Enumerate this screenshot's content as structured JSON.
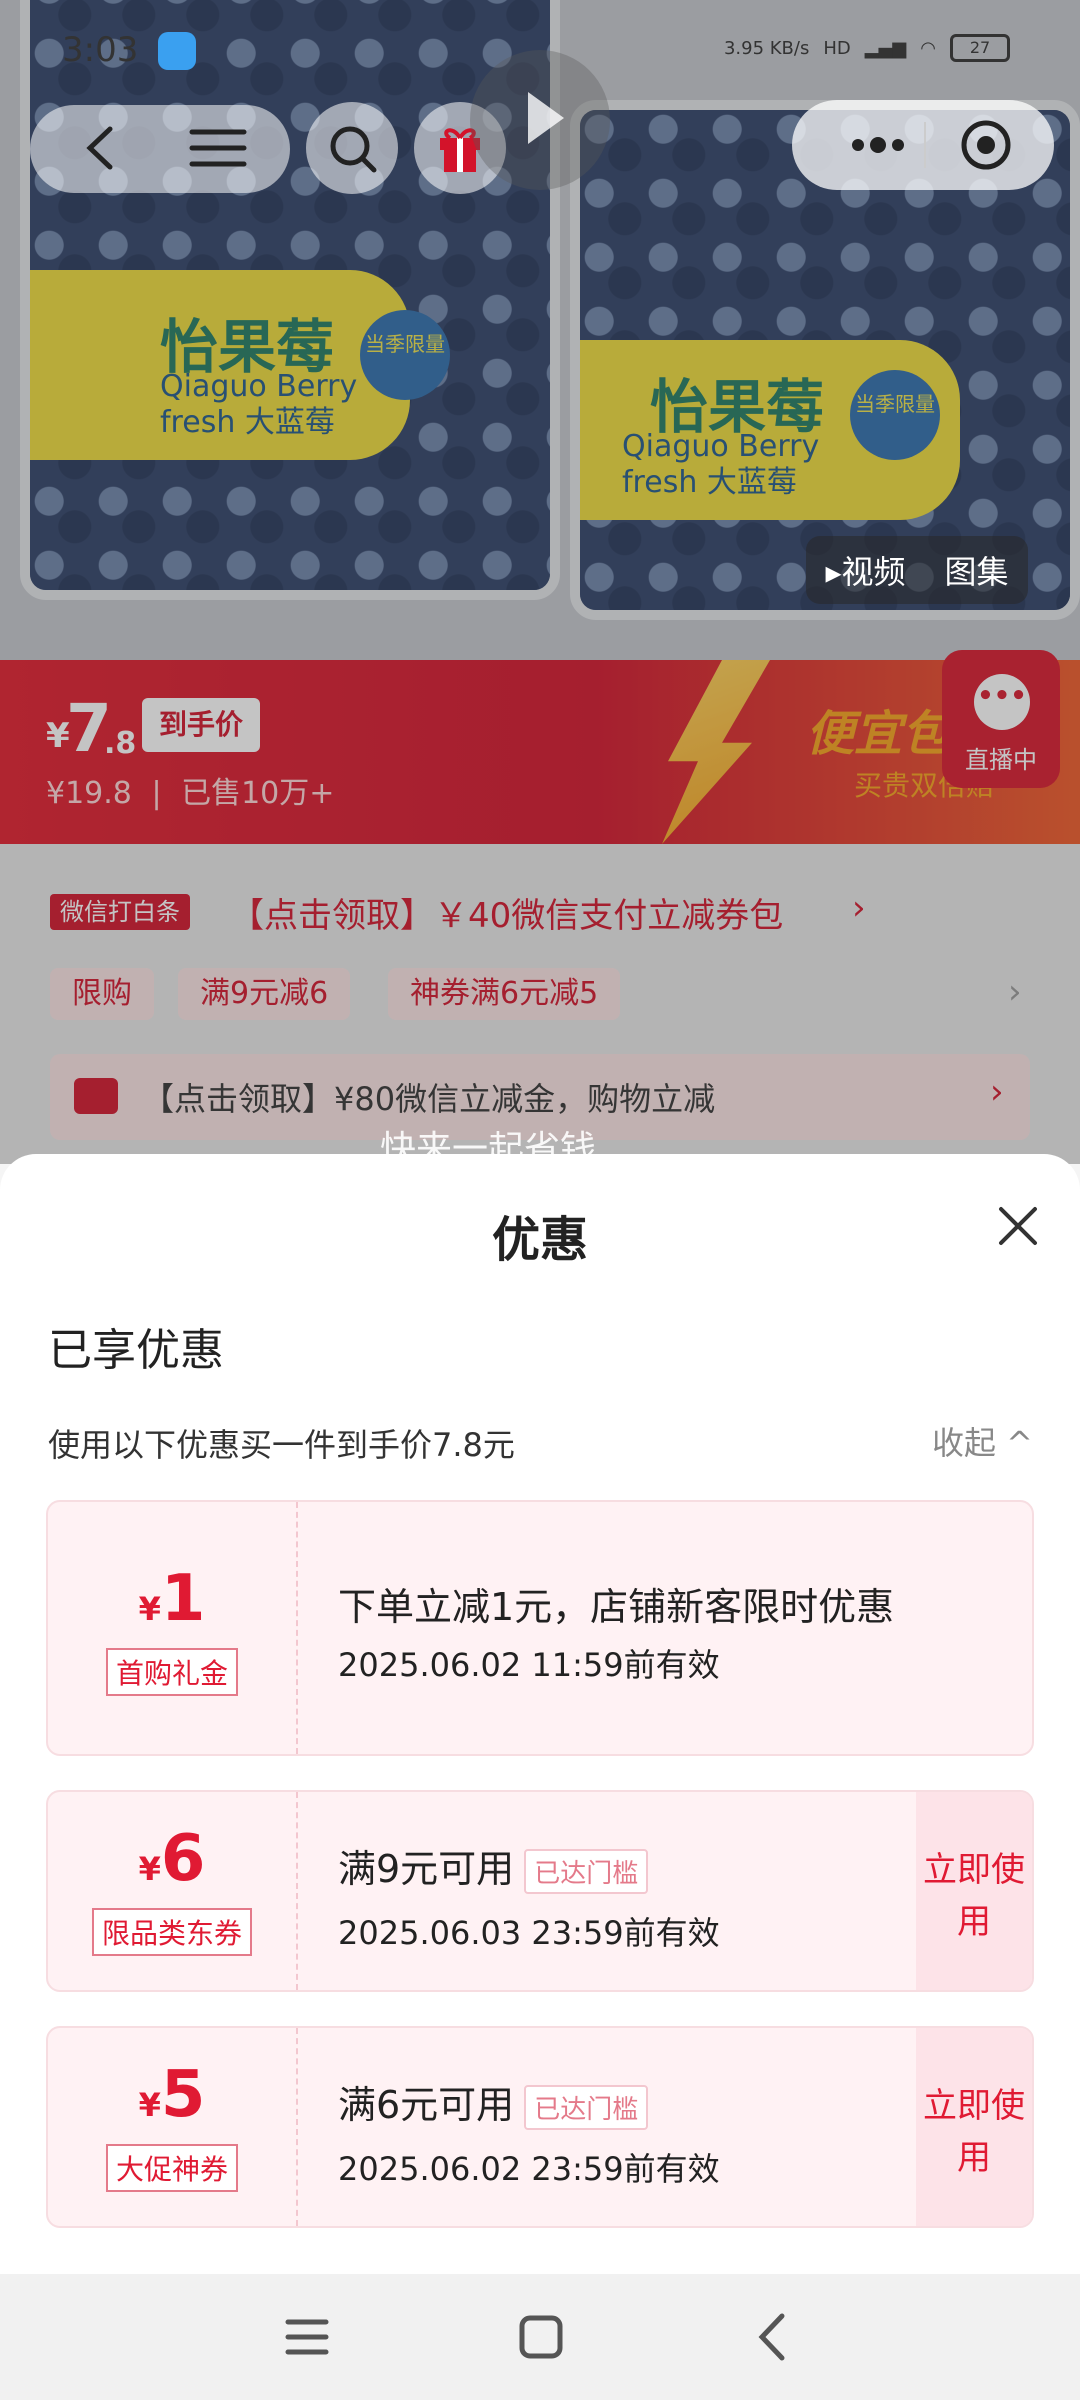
{
  "status_bar": {
    "time": "3:03",
    "net_speed": "3.95 KB/s",
    "net_type": "HD",
    "battery": "27"
  },
  "media": {
    "video_tab": "▸视频",
    "gallery_tab": "图集"
  },
  "product_label": {
    "brand_cn": "怡果莓",
    "brand_en_1": "Qiaguo Berry",
    "brand_en_2": "fresh 大蓝莓",
    "badge": "当季限量"
  },
  "price": {
    "symbol": "¥",
    "integer": "7",
    "decimal": ".8",
    "tag": "到手价",
    "original": "¥19.8",
    "sold": "已售10万+"
  },
  "promo_banner": {
    "title": "便宜包",
    "subtitle": "买贵双倍赔"
  },
  "live": {
    "label": "直播中",
    "icon": "chat-bubble-icon"
  },
  "coupon_strip": {
    "wechat_badge": "微信打白条",
    "wechat_text": "【点击领取】￥40微信支付立减券包",
    "tags": [
      "限购",
      "满9元减6",
      "神券满6元减5"
    ],
    "card_text": "【点击领取】¥80微信立减金，购物立减"
  },
  "watermark": "快来一起省钱",
  "sheet": {
    "title": "优惠",
    "enjoyed": "已享优惠",
    "hint": "使用以下优惠买一件到手价7.8元",
    "collapse": "收起 ^",
    "coupons": [
      {
        "symbol": "¥",
        "amount": "1",
        "kind": "首购礼金",
        "main": "下单立减1元，店铺新客限时优惠",
        "date": "2025.06.02 11:59前有效"
      },
      {
        "symbol": "¥",
        "amount": "6",
        "kind": "限品类东券",
        "main": "满9元可用",
        "reached": "已达门槛",
        "date": "2025.06.03 23:59前有效",
        "use": "立即使用"
      },
      {
        "symbol": "¥",
        "amount": "5",
        "kind": "大促神券",
        "main": "满6元可用",
        "reached": "已达门槛",
        "date": "2025.06.02 23:59前有效",
        "use": "立即使用"
      }
    ]
  },
  "colors": {
    "accent": "#e01a33",
    "banner": "#d3132a"
  }
}
